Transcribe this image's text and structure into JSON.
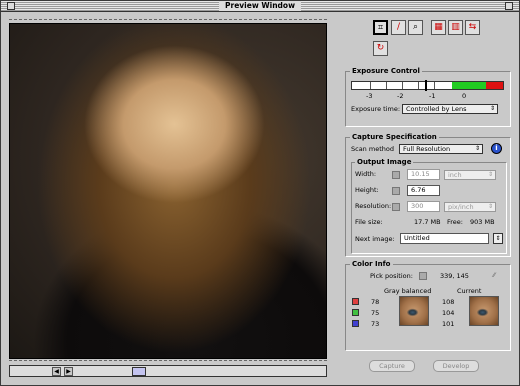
{
  "window": {
    "title": "Preview Window"
  },
  "toolbar": {
    "icons": [
      "crop-icon",
      "eyedropper-icon",
      "zoom-icon",
      "pattern-a-icon",
      "pattern-b-icon",
      "flip-icon",
      "rotate-icon"
    ]
  },
  "exposure": {
    "title": "Exposure Control",
    "scale": [
      "-3",
      "-2",
      "-1",
      "0"
    ],
    "time_label": "Exposure time:",
    "time_value": "Controlled by Lens",
    "colors": {
      "green": "#22cc22",
      "red": "#dd1111"
    }
  },
  "capture": {
    "title": "Capture Specification",
    "scan_label": "Scan method",
    "scan_value": "Full Resolution",
    "info_label": "i",
    "output": {
      "title": "Output Image",
      "width_label": "Width:",
      "width_value": "10.15",
      "width_unit": "inch",
      "height_label": "Height:",
      "height_value": "6.76",
      "res_label": "Resolution:",
      "res_value": "300",
      "res_unit": "pix/inch",
      "filesize_label": "File size:",
      "filesize_value": "17.7 MB",
      "free_label": "Free:",
      "free_value": "903 MB",
      "next_label": "Next image:",
      "next_value": "Untitled"
    }
  },
  "color": {
    "title": "Color Info",
    "pick_label": "Pick position:",
    "pick_value": "339, 145",
    "gray_label": "Gray balanced",
    "current_label": "Current",
    "rows": [
      {
        "swatch": "#e04040",
        "gray": "78",
        "current": "108"
      },
      {
        "swatch": "#40c040",
        "gray": "75",
        "current": "104"
      },
      {
        "swatch": "#4040d0",
        "gray": "73",
        "current": "101"
      }
    ]
  },
  "buttons": {
    "capture": "Capture",
    "develop": "Develop"
  }
}
